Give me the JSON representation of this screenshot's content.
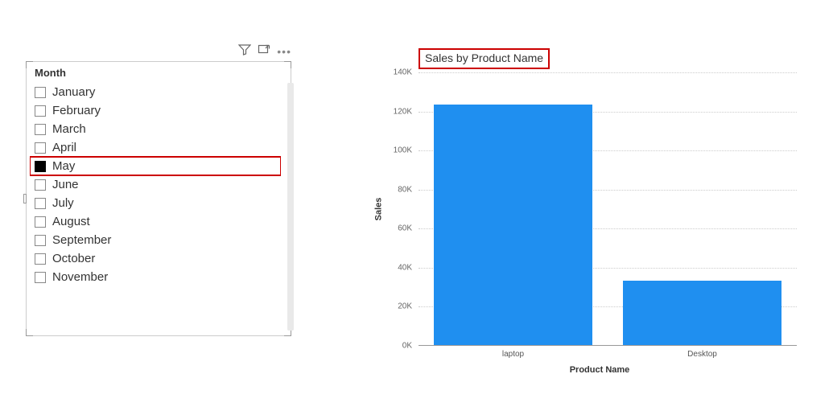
{
  "slicer": {
    "header": "Month",
    "selected_index": 4,
    "items": [
      {
        "label": "January",
        "checked": false
      },
      {
        "label": "February",
        "checked": false
      },
      {
        "label": "March",
        "checked": false
      },
      {
        "label": "April",
        "checked": false
      },
      {
        "label": "May",
        "checked": true
      },
      {
        "label": "June",
        "checked": false
      },
      {
        "label": "July",
        "checked": false
      },
      {
        "label": "August",
        "checked": false
      },
      {
        "label": "September",
        "checked": false
      },
      {
        "label": "October",
        "checked": false
      },
      {
        "label": "November",
        "checked": false
      }
    ]
  },
  "toolbar": {
    "filter_icon": "filter-icon",
    "focus_icon": "focus-mode-icon",
    "more_icon": "more-options-icon"
  },
  "chart_data": {
    "type": "bar",
    "title": "Sales by Product Name",
    "xlabel": "Product Name",
    "ylabel": "Sales",
    "categories": [
      "laptop",
      "Desktop"
    ],
    "values": [
      123000,
      33000
    ],
    "ylim": [
      0,
      140000
    ],
    "y_ticks": [
      0,
      20000,
      40000,
      60000,
      80000,
      100000,
      120000,
      140000
    ],
    "y_tick_labels": [
      "0K",
      "20K",
      "40K",
      "60K",
      "80K",
      "100K",
      "120K",
      "140K"
    ],
    "bar_color": "#1f8ff0"
  }
}
